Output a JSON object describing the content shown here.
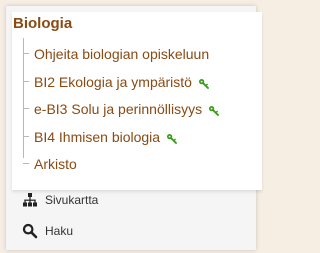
{
  "menu": {
    "title": "Biologia",
    "items": [
      {
        "label": "Ohjeita biologian opiskeluun",
        "icon": null
      },
      {
        "label": "BI2 Ekologia ja ympäristö",
        "icon": "key-icon"
      },
      {
        "label": "e-BI3 Solu ja perinnöllisyys",
        "icon": "key-icon"
      },
      {
        "label": "BI4 Ihmisen biologia",
        "icon": "key-icon"
      },
      {
        "label": "Arkisto",
        "icon": null
      }
    ]
  },
  "footer": {
    "sitemap_label": "Sivukartta",
    "sitemap_icon": "sitemap-icon",
    "search_label": "Haku",
    "search_icon": "search-icon"
  },
  "colors": {
    "link": "#8a4a13",
    "key": "#3c9a1b",
    "background": "#f6ede3"
  }
}
